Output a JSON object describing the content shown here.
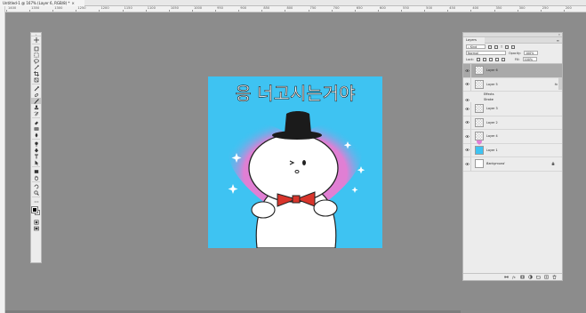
{
  "document": {
    "tab_title": "Untitled-1 @ 167% (Layer 6, RGB/8) *",
    "tab_close": "×"
  },
  "ruler": {
    "labels": [
      "1400",
      "1350",
      "1300",
      "1250",
      "1200",
      "1150",
      "1100",
      "1050",
      "1000",
      "950",
      "900",
      "850",
      "800",
      "750",
      "700",
      "650",
      "600",
      "550",
      "500",
      "450",
      "400",
      "350",
      "300",
      "250",
      "200"
    ]
  },
  "toolbar": {
    "grip_label": "»",
    "tools": [
      "move-icon",
      "artboard-icon",
      "marquee-icon",
      "lasso-icon",
      "magic-wand-icon",
      "crop-icon",
      "frame-icon",
      "eyedropper-icon",
      "healing-brush-icon",
      "brush-icon",
      "clone-stamp-icon",
      "history-brush-icon",
      "eraser-icon",
      "gradient-icon",
      "blur-icon",
      "dodge-icon",
      "pen-icon",
      "type-icon",
      "path-selection-icon",
      "rectangle-icon",
      "hand-icon",
      "rotate-view-icon",
      "zoom-icon",
      "more-tools-icon"
    ],
    "active_tool": "brush-icon",
    "foreground_color": "#000000",
    "background_color": "#ffffff"
  },
  "canvas": {
    "background": "#3ec3f2",
    "heart_color": "#e07fd4",
    "text": "응 너고시는거야",
    "bow_color": "#d9352c"
  },
  "layers_panel": {
    "tab_label": "Layers",
    "kind_filter": "Kind",
    "blend_mode": "Normal",
    "opacity_label": "Opacity:",
    "opacity_value": "100%",
    "lock_label": "Lock:",
    "fill_label": "Fill:",
    "fill_value": "100%",
    "layers": [
      {
        "name": "Layer 6",
        "thumb": "checker",
        "selected": true,
        "visible": true
      },
      {
        "name": "Layer 5",
        "thumb": "checker",
        "selected": false,
        "visible": true,
        "fx": "fx"
      },
      {
        "name": "Effects",
        "sub": true
      },
      {
        "name": "Stroke",
        "sub": true
      },
      {
        "name": "Layer 3",
        "thumb": "checker",
        "selected": false,
        "visible": true
      },
      {
        "name": "Layer 2",
        "thumb": "checker",
        "selected": false,
        "visible": true
      },
      {
        "name": "Layer 4",
        "thumb": "heart",
        "selected": false,
        "visible": true
      },
      {
        "name": "Layer 1",
        "thumb": "blue",
        "selected": false,
        "visible": true
      },
      {
        "name": "Background",
        "thumb": "white",
        "selected": false,
        "visible": true,
        "locked": true
      }
    ],
    "bottom_buttons": [
      "link-icon",
      "fx-icon",
      "mask-icon",
      "adjustment-icon",
      "group-icon",
      "new-layer-icon",
      "trash-icon"
    ]
  },
  "colors": {
    "workspace": "#8c8c8c",
    "panel": "#ececec",
    "selected_layer": "#a9a9a9"
  }
}
